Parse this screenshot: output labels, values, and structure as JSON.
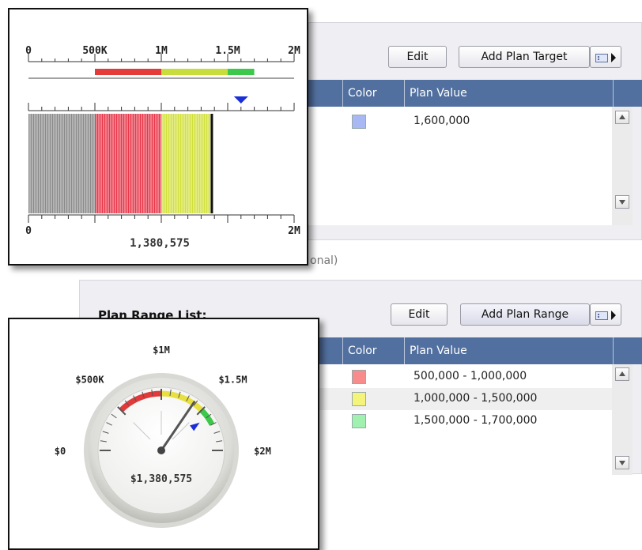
{
  "top_section": {
    "edit_label": "Edit",
    "add_label": "Add Plan Target",
    "columns": {
      "color": "Color",
      "plan_value": "Plan Value"
    },
    "rows": [
      {
        "color": "#a8b8f4",
        "value": "1,600,000"
      }
    ]
  },
  "optional_fragment": "onal)",
  "bottom_section": {
    "title": "Plan Range List:",
    "edit_label": "Edit",
    "add_label": "Add Plan Range",
    "columns": {
      "color": "Color",
      "plan_value": "Plan Value"
    },
    "rows": [
      {
        "color": "#f88c8c",
        "value": "500,000 - 1,000,000"
      },
      {
        "color": "#f4f47a",
        "value": "1,000,000 - 1,500,000"
      },
      {
        "color": "#a0f0b0",
        "value": "1,500,000 - 1,700,000"
      }
    ]
  },
  "bullet": {
    "scale_labels": [
      "0",
      "500K",
      "1M",
      "1.5M",
      "2M"
    ],
    "bottom_labels": [
      "0",
      "2M"
    ],
    "value_label": "1,380,575",
    "min": 0,
    "max": 2000000,
    "value": 1380575,
    "target": 1600000,
    "ranges": [
      {
        "from": 500000,
        "to": 1000000,
        "color": "#e53a3a"
      },
      {
        "from": 1000000,
        "to": 1500000,
        "color": "#c8dc3c"
      },
      {
        "from": 1500000,
        "to": 1700000,
        "color": "#3cc84a"
      }
    ],
    "bar_segments": [
      {
        "from": 0,
        "to": 500000,
        "color": "#8a8a8a"
      },
      {
        "from": 500000,
        "to": 1000000,
        "color": "#e8384a"
      },
      {
        "from": 1000000,
        "to": 1380575,
        "color": "#d2e03c"
      }
    ]
  },
  "gauge": {
    "labels": [
      "$0",
      "$500K",
      "$1M",
      "$1.5M",
      "$2M"
    ],
    "value_label": "$1,380,575",
    "min": 0,
    "max": 2000000,
    "value": 1380575,
    "target": 1600000,
    "ranges": [
      {
        "from": 500000,
        "to": 1000000,
        "color": "#e03a3a"
      },
      {
        "from": 1000000,
        "to": 1500000,
        "color": "#e8e040"
      },
      {
        "from": 1500000,
        "to": 1700000,
        "color": "#3cc84a"
      }
    ]
  }
}
